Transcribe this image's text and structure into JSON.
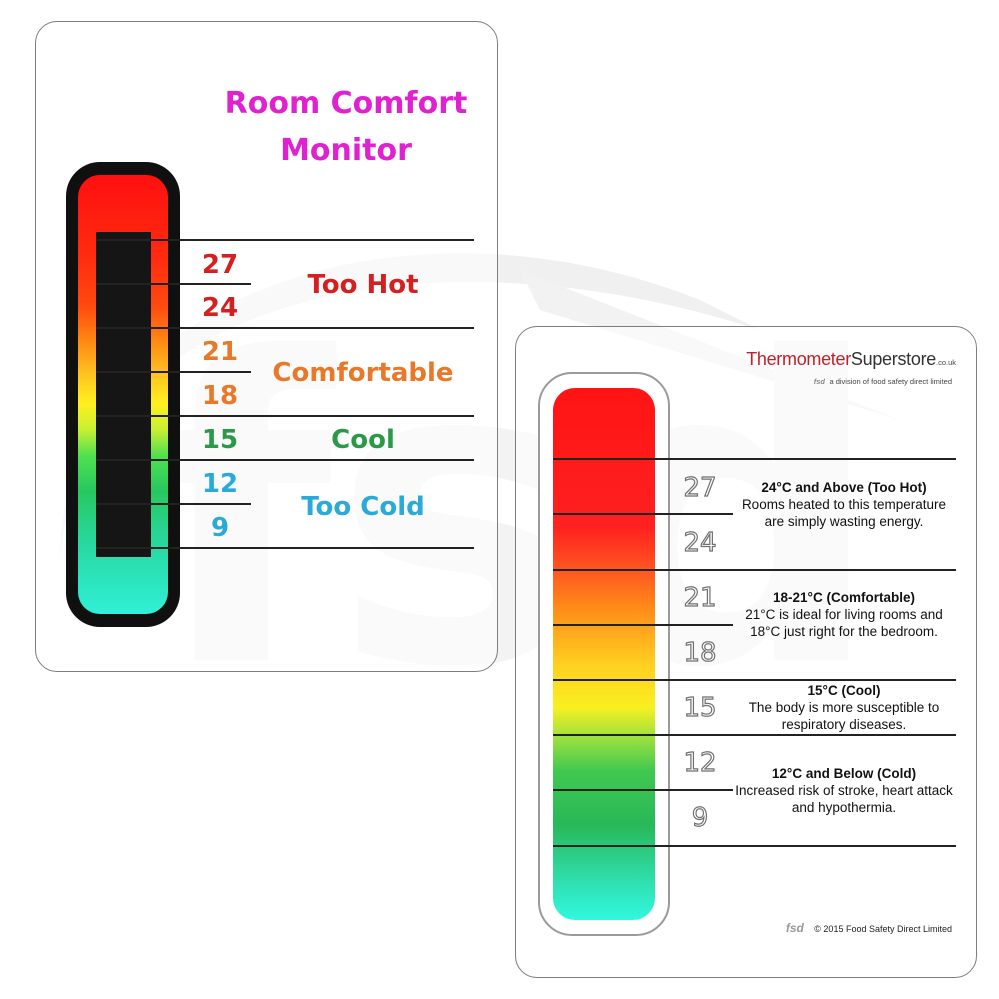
{
  "front": {
    "title_line1": "Room Comfort",
    "title_line2": "Monitor",
    "title_color": "#e021d0",
    "scale": [
      {
        "value": "27",
        "color": "#d42020"
      },
      {
        "value": "24",
        "color": "#d42020"
      },
      {
        "value": "21",
        "color": "#e8782a"
      },
      {
        "value": "18",
        "color": "#e8782a"
      },
      {
        "value": "15",
        "color": "#2a9a48"
      },
      {
        "value": "12",
        "color": "#2aaad8"
      },
      {
        "value": "9",
        "color": "#2aaad8"
      }
    ],
    "zones": [
      {
        "label": "Too Hot",
        "color": "#d42020"
      },
      {
        "label": "Comfortable",
        "color": "#e8782a"
      },
      {
        "label": "Cool",
        "color": "#2a9a48"
      },
      {
        "label": "Too Cold",
        "color": "#2aaad8"
      }
    ]
  },
  "back": {
    "brand_part1": "Thermometer",
    "brand_part2": "Superstore",
    "brand_suffix": ".co.uk",
    "brand_color": "#c0202a",
    "division_logo": "fsd",
    "division_text": "a division of food safety direct limited",
    "scale": [
      "27",
      "24",
      "21",
      "18",
      "15",
      "12",
      "9"
    ],
    "descriptions": [
      {
        "heading": "24°C and Above",
        "qualifier": "(Too Hot)",
        "text": "Rooms heated to this temperature are simply wasting energy."
      },
      {
        "heading": "18-21°C",
        "qualifier": "(Comfortable)",
        "text": "21°C is ideal for living rooms and 18°C just right for the bedroom."
      },
      {
        "heading": "15°C",
        "qualifier": "(Cool)",
        "text": "The body is more susceptible to respiratory diseases."
      },
      {
        "heading": "12°C and Below",
        "qualifier": "(Cold)",
        "text": "Increased risk of stroke, heart attack and hypothermia."
      }
    ],
    "footer_logo": "fsd",
    "copyright": "© 2015 Food Safety Direct Limited"
  }
}
